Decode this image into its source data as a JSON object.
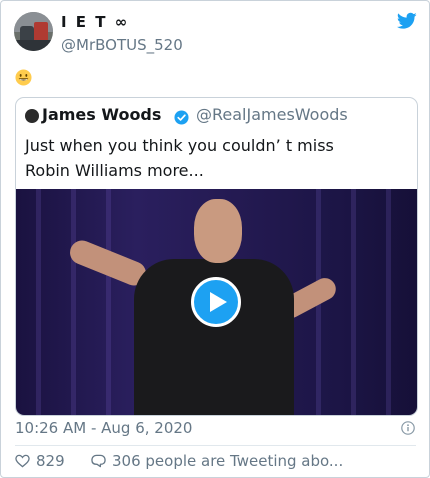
{
  "author": {
    "name": "I E T ∞",
    "handle": "@MrBOTUS_520"
  },
  "tweet_emoji": "grinning-face-emoji",
  "quoted_tweet": {
    "name": "James Woods",
    "handle": "@RealJamesWoods",
    "verified": true,
    "text": "Just when you think you couldn’ t miss\nRobin Williams more...",
    "media": "video"
  },
  "timestamp": "10:26 AM - Aug 6, 2020",
  "stats": {
    "likes": "829",
    "talking": "306 people are Tweeting abo..."
  },
  "colors": {
    "twitter_blue": "#1da1f2",
    "secondary_text": "#657786",
    "border": "#c9d2da"
  }
}
